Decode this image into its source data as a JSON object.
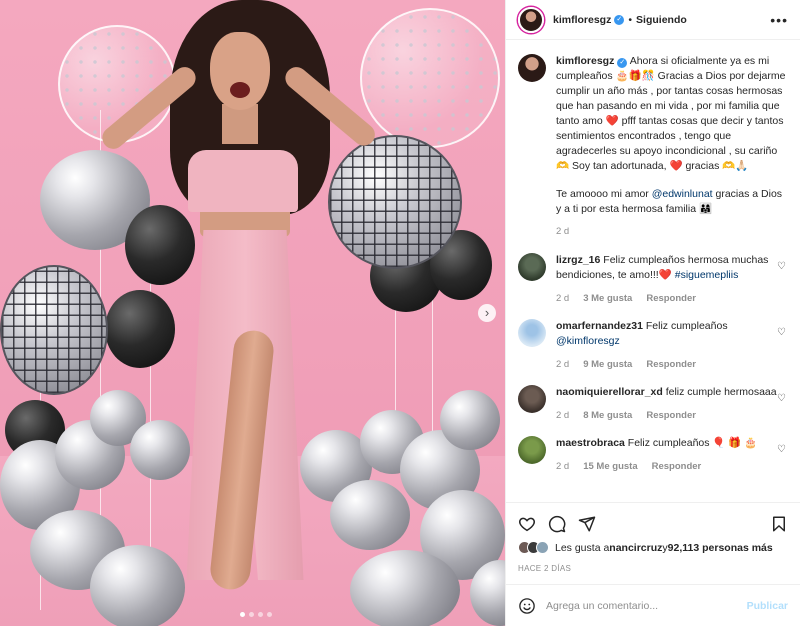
{
  "post": {
    "username": "kimfloresgz",
    "verified_mark": "✓",
    "separator": "•",
    "follow_label": "Siguiendo",
    "more_label": "•••",
    "caption_p1": "Ahora si oficialmente ya es mi cumpleaños 🎂🎁🎊 Gracias a Dios por dejarme cumplir un año más , por tantas cosas hermosas que han pasando en mi vida , por mi familia que tanto amo ❤️ pfff tantas cosas que decir y tantos sentimientos encontrados , tengo que agradecerles su apoyo incondicional , su cariño 🫶 Soy tan adortunada, ❤️ gracias 🫶🙏🏻",
    "caption_p2_pre": "Te amoooo mi amor ",
    "caption_p2_mention": "@edwinlunat",
    "caption_p2_post": " gracias a Dios y a ti por esta hermosa familia 👨‍👩‍👧",
    "caption_time": "2 d"
  },
  "comments": [
    {
      "user": "lizrgz_16",
      "text": "Feliz cumpleaños hermosa muchas bendiciones, te amo!!!❤️ ",
      "mention": "#siguemepliis",
      "time": "2 d",
      "likes": "3 Me gusta",
      "reply": "Responder"
    },
    {
      "user": "omarfernandez31",
      "text": "Feliz cumpleaños ",
      "mention": "@kimfloresgz",
      "time": "2 d",
      "likes": "9 Me gusta",
      "reply": "Responder"
    },
    {
      "user": "naomiquierellorar_xd",
      "text": "feliz cumple hermosaaa",
      "mention": "",
      "time": "2 d",
      "likes": "8 Me gusta",
      "reply": "Responder"
    },
    {
      "user": "maestrobraca",
      "text": "Feliz cumpleaños 🎈 🎁 🎂",
      "mention": "",
      "time": "2 d",
      "likes": "15 Me gusta",
      "reply": "Responder"
    }
  ],
  "likes": {
    "prefix": "Les gusta a ",
    "user": "nancircruz",
    "middle": " y ",
    "count": "92,113 personas más"
  },
  "date_label": "HACE 2 DÍAS",
  "add_comment": {
    "placeholder": "Agrega un comentario...",
    "publish_label": "Publicar"
  },
  "carousel": {
    "next": "›",
    "slides": 4,
    "active": 1
  },
  "colors": {
    "accent": "#3897f0",
    "mention": "#00376b",
    "publish_disabled": "#b2dffc",
    "heart_red": "#ed4956",
    "photo_bg": "#f4a8bf"
  }
}
